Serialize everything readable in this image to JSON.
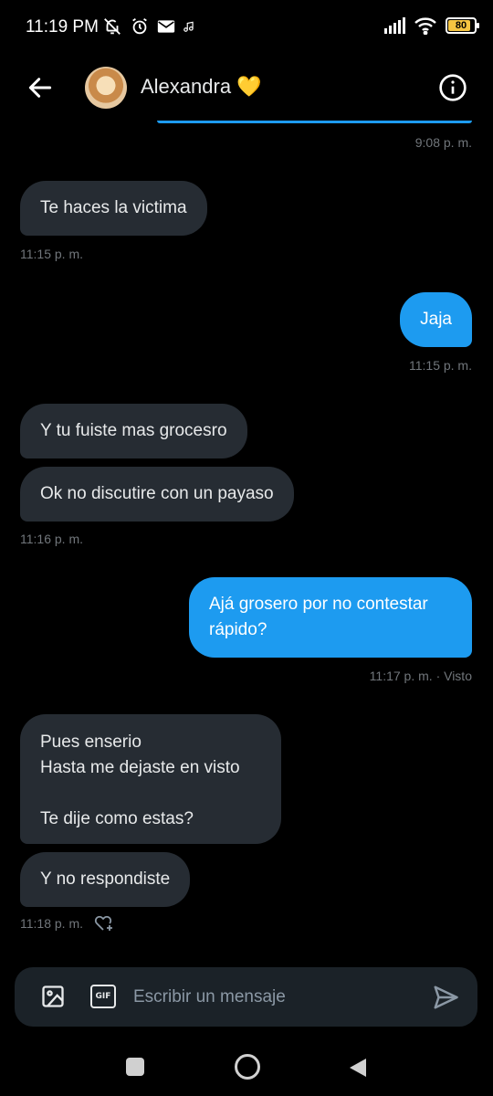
{
  "status_bar": {
    "time": "11:19 PM",
    "battery": "80",
    "left_icons": [
      "mute-icon",
      "alarm-icon",
      "mail-icon",
      "music-icon"
    ],
    "right_icons": [
      "signal-icon",
      "wifi-icon",
      "battery-icon"
    ]
  },
  "header": {
    "contact_name": "Alexandra 💛",
    "back_icon": "arrow-left-icon",
    "info_icon": "info-icon"
  },
  "messages": [
    {
      "side": "out",
      "text": "",
      "time": "9:08 p. m."
    },
    {
      "side": "in",
      "text": "Te haces la victima",
      "time": "11:15 p. m."
    },
    {
      "side": "out",
      "text": "Jaja",
      "time": "11:15 p. m."
    },
    {
      "side": "in",
      "text": "Y tu fuiste mas grocesro",
      "time": ""
    },
    {
      "side": "in",
      "text": "Ok no discutire con un payaso",
      "time": "11:16 p. m."
    },
    {
      "side": "out",
      "text": "Ajá grosero por no contestar\nrápido?",
      "time": "11:17 p. m. · Visto"
    },
    {
      "side": "in",
      "text": "Pues enserio\nHasta me dejaste en visto\n\nTe dije como estas?",
      "time": ""
    },
    {
      "side": "in",
      "text": "Y no respondiste",
      "time": "11:18 p. m."
    }
  ],
  "composer": {
    "placeholder": "Escribir un mensaje",
    "gif_label": "GIF"
  },
  "colors": {
    "outgoing_bubble": "#1d9bf0",
    "incoming_bubble": "#262c33",
    "background": "#000000",
    "meta_text": "#71767b"
  }
}
